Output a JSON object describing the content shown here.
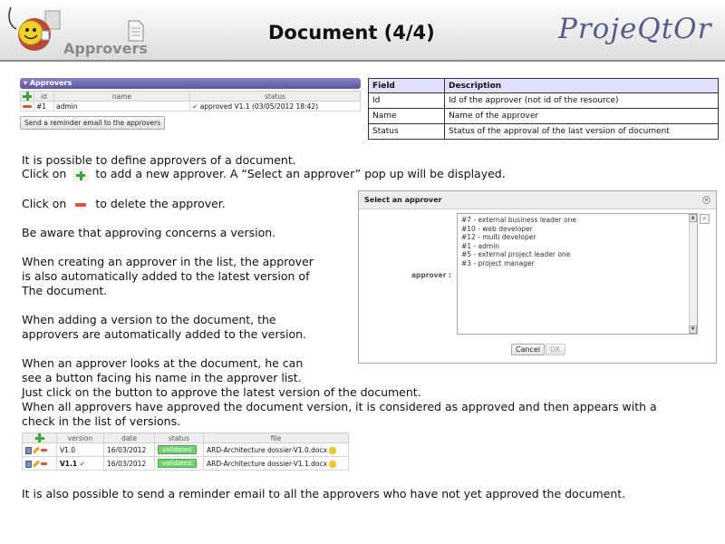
{
  "header": {
    "section": "Approvers",
    "title": "Document (4/4)",
    "brand": "ProjeQtOr"
  },
  "approvers_panel": {
    "title": "Approvers",
    "columns": [
      "id",
      "name",
      "status"
    ],
    "row": {
      "id": "#1",
      "name": "admin",
      "status": "approved V1.1 (03/05/2012 18:42)"
    },
    "reminder_button": "Send a reminder email to the approvers"
  },
  "fields_table": {
    "headers": [
      "Field",
      "Description"
    ],
    "rows": [
      [
        "Id",
        "Id of the approver (not id of the resource)"
      ],
      [
        "Name",
        "Name of the approver"
      ],
      [
        "Status",
        "Status of the approval of the last version of document"
      ]
    ]
  },
  "text": {
    "p1": "It is possible to define approvers of a document.",
    "p2a": "Click on",
    "p2b": "to add a new approver. A “Select an approver” pop up will be displayed.",
    "p3a": "Click on",
    "p3b": "to delete the approver.",
    "p4": "Be aware that approving concerns a version.",
    "p5_1": "When creating an approver in the list, the approver",
    "p5_2": "is also automatically added to the latest version of",
    "p5_3": "The document.",
    "p6_1": "When adding a version to the document, the",
    "p6_2": "approvers are automatically added to the version.",
    "p7_1": "When an approver looks at the document, he can",
    "p7_2": "see a button facing his name in the approver list.",
    "p7_3": "Just click on the button to approve the latest version of the document.",
    "p8_1": "When all approvers have approved the document version, it is considered as approved and then appears with a",
    "p8_2": "check in the list of versions.",
    "p9": "It is also possible to send a reminder email to all the approvers who have not yet approved the document."
  },
  "dialog": {
    "title": "Select an approver",
    "label": "approver :",
    "options": [
      "#7 - external business leader one",
      "#10 - web developer",
      "#12 - multi developer",
      "#1 - admin",
      "#5 - external project leader one",
      "#3 - project manager"
    ],
    "cancel": "Cancel",
    "ok": "OK"
  },
  "versions": {
    "columns": [
      "version",
      "date",
      "status",
      "file"
    ],
    "rows": [
      {
        "version": "V1.0",
        "date": "16/03/2012",
        "status": "validated",
        "file": "ARD-Architecture dossier-V1.0.docx"
      },
      {
        "version": "V1.1",
        "date": "16/03/2012",
        "status": "validated",
        "file": "ARD-Architecture dossier-V1.1.docx"
      }
    ]
  },
  "colors": {
    "brand": "#595a8c",
    "panel_header": "#6a62ad",
    "add": "#3aa63a",
    "delete": "#e0533a",
    "validated": "#6dd26d"
  },
  "icons": [
    "mascot-logo",
    "document-icon",
    "add-icon",
    "delete-icon",
    "check-icon",
    "close-icon",
    "search-icon"
  ]
}
